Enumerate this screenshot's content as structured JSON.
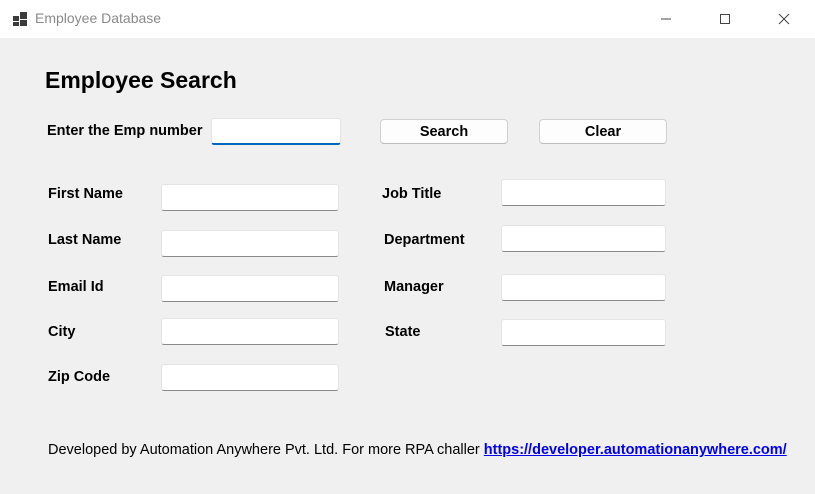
{
  "window": {
    "title": "Employee Database",
    "icon": "app-window-icon",
    "controls": {
      "minimize": "minimize-icon",
      "maximize": "maximize-icon",
      "close": "close-icon"
    }
  },
  "form": {
    "heading": "Employee Search",
    "emp_number": {
      "label": "Enter the Emp number",
      "value": ""
    },
    "search_label": "Search",
    "clear_label": "Clear",
    "fields": {
      "first_name": {
        "label": "First Name",
        "value": ""
      },
      "last_name": {
        "label": "Last Name",
        "value": ""
      },
      "email_id": {
        "label": "Email Id",
        "value": ""
      },
      "city": {
        "label": "City",
        "value": ""
      },
      "zip_code": {
        "label": "Zip Code",
        "value": ""
      },
      "job_title": {
        "label": "Job Title",
        "value": ""
      },
      "department": {
        "label": "Department",
        "value": ""
      },
      "manager": {
        "label": "Manager",
        "value": ""
      },
      "state": {
        "label": "State",
        "value": ""
      }
    }
  },
  "footer": {
    "text": "Developed by Automation Anywhere Pvt. Ltd. For more RPA challer",
    "link_text": "https://developer.automationanywhere.com/"
  },
  "colors": {
    "window_bg": "#f0f0f0",
    "titlebar_bg": "#ffffff",
    "focus_accent": "#0067c0",
    "link": "#0000ee"
  }
}
